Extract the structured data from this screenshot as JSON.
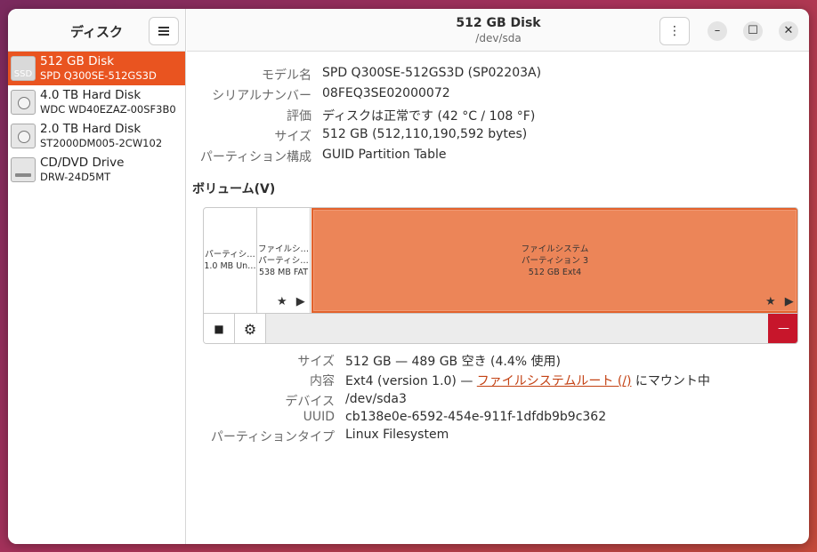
{
  "sidebar": {
    "title": "ディスク",
    "disks": [
      {
        "name": "512 GB Disk",
        "model": "SPD Q300SE-512GS3D",
        "icon": "ssd-icon",
        "icon_text": "SSD",
        "selected": true
      },
      {
        "name": "4.0 TB Hard Disk",
        "model": "WDC WD40EZAZ-00SF3B0",
        "icon": "hdd-icon"
      },
      {
        "name": "2.0 TB Hard Disk",
        "model": "ST2000DM005-2CW102",
        "icon": "hdd-icon"
      },
      {
        "name": "CD/DVD Drive",
        "model": "DRW-24D5MT",
        "icon": "dvd-icon"
      }
    ]
  },
  "header": {
    "title": "512 GB Disk",
    "subtitle": "/dev/sda",
    "kebab": "⋮",
    "minimize": "–",
    "maximize": "☐",
    "close": "✕"
  },
  "disk_info": [
    {
      "label": "モデル名",
      "value": "SPD Q300SE-512GS3D (SP02203A)"
    },
    {
      "label": "シリアルナンバー",
      "value": "08FEQ3SE02000072"
    },
    {
      "label": "評価",
      "value": "ディスクは正常です (42 °C / 108 °F)"
    },
    {
      "label": "サイズ",
      "value": "512 GB (512,110,190,592 bytes)"
    },
    {
      "label": "パーティション構成",
      "value": "GUID Partition Table"
    }
  ],
  "volumes": {
    "title": "ボリューム(V)",
    "partitions": [
      {
        "lines": [
          "パーティシ…",
          "1.0 MB Un…"
        ]
      },
      {
        "lines": [
          "ファイルシ…",
          "パーティシ…",
          "538 MB FAT"
        ]
      },
      {
        "lines": [
          "ファイルシステム",
          "パーティション 3",
          "512 GB Ext4"
        ]
      }
    ],
    "marker": "★ ▶",
    "stop_symbol": "■",
    "settings_symbol": "⚙",
    "delete_symbol": "—"
  },
  "partition_details": {
    "size": {
      "label": "サイズ",
      "value": "512 GB — 489 GB 空き (4.4% 使用)"
    },
    "contents": {
      "label": "内容",
      "prefix": "Ext4 (version 1.0) — ",
      "link": "ファイルシステムルート (/)",
      "suffix": " にマウント中"
    },
    "device": {
      "label": "デバイス",
      "value": "/dev/sda3"
    },
    "uuid": {
      "label": "UUID",
      "value": "cb138e0e-6592-454e-911f-1dfdb9b9c362"
    },
    "ptype": {
      "label": "パーティションタイプ",
      "value": "Linux Filesystem"
    }
  },
  "colors": {
    "accent": "#e95420",
    "partition_fill": "#ec8558",
    "danger": "#c7162b"
  }
}
